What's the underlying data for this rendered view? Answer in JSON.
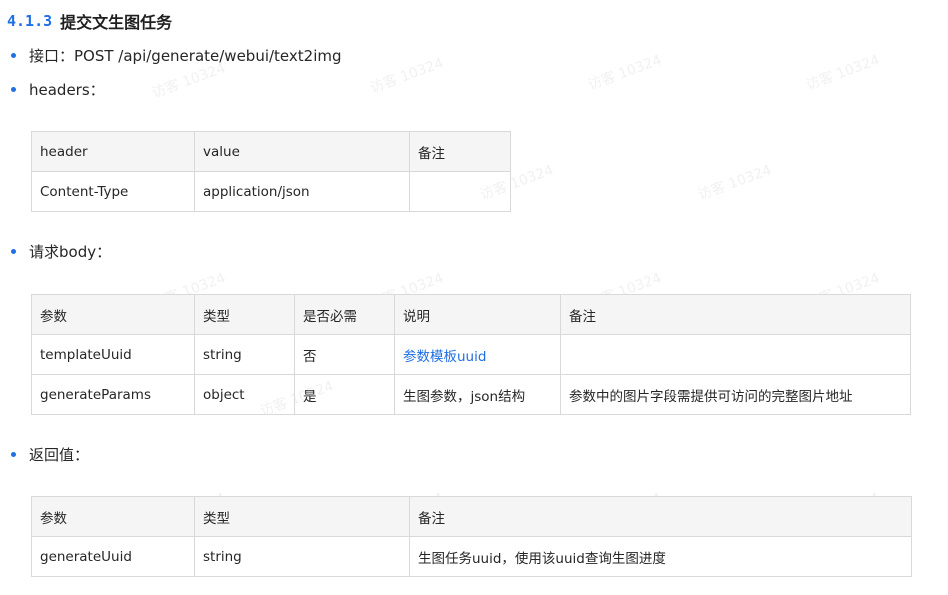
{
  "section": {
    "number": "4.1.3",
    "title": "提交文生图任务"
  },
  "bullets": {
    "endpoint": "接口：POST /api/generate/webui/text2img",
    "headers": "headers：",
    "body": "请求body：",
    "returns": "返回值："
  },
  "headers_table": {
    "columns": [
      "header",
      "value",
      "备注"
    ],
    "rows": [
      [
        "Content-Type",
        "application/json",
        ""
      ]
    ]
  },
  "body_table": {
    "columns": [
      "参数",
      "类型",
      "是否必需",
      "说明",
      "备注"
    ],
    "rows": [
      [
        "templateUuid",
        "string",
        "否",
        "参数模板uuid",
        ""
      ],
      [
        "generateParams",
        "object",
        "是",
        "生图参数，json结构",
        "参数中的图片字段需提供可访问的完整图片地址"
      ]
    ]
  },
  "return_table": {
    "columns": [
      "参数",
      "类型",
      "备注"
    ],
    "rows": [
      [
        "generateUuid",
        "string",
        "生图任务uuid，使用该uuid查询生图进度"
      ]
    ]
  },
  "watermark": "访客 10324",
  "colors": {
    "accent": "#1f6fe5",
    "header_bg": "#f5f5f5",
    "border": "#d9d9d9"
  }
}
